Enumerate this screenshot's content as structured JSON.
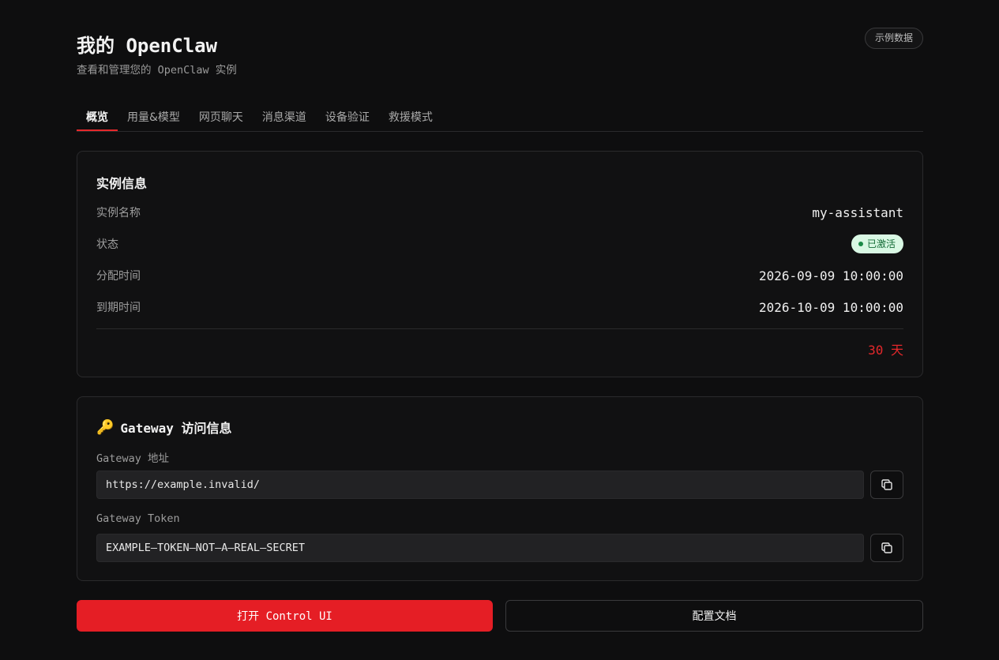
{
  "header": {
    "title": "我的 OpenClaw",
    "subtitle": "查看和管理您的 OpenClaw 实例",
    "badge": "示例数据"
  },
  "tabs": [
    {
      "label": "概览",
      "active": true
    },
    {
      "label": "用量&模型",
      "active": false
    },
    {
      "label": "网页聊天",
      "active": false
    },
    {
      "label": "消息渠道",
      "active": false
    },
    {
      "label": "设备验证",
      "active": false
    },
    {
      "label": "救援模式",
      "active": false
    }
  ],
  "instance": {
    "title": "实例信息",
    "name_label": "实例名称",
    "name_value": "my-assistant",
    "status_label": "状态",
    "status_value": "已激活",
    "assigned_label": "分配时间",
    "assigned_value": "2026-09-09 10:00:00",
    "expire_label": "到期时间",
    "expire_value": "2026-10-09 10:00:00",
    "remaining": "30 天"
  },
  "gateway": {
    "icon": "key-icon",
    "title": "Gateway 访问信息",
    "address_label": "Gateway 地址",
    "address_value": "https://example.invalid/",
    "token_label": "Gateway Token",
    "token_value": "EXAMPLE–TOKEN–NOT–A–REAL–SECRET"
  },
  "actions": {
    "open_label": "打开 Control UI",
    "docs_label": "配置文档"
  },
  "colors": {
    "accent": "#e51e25",
    "status_bg": "#d9f8e4",
    "status_text": "#136b36"
  }
}
